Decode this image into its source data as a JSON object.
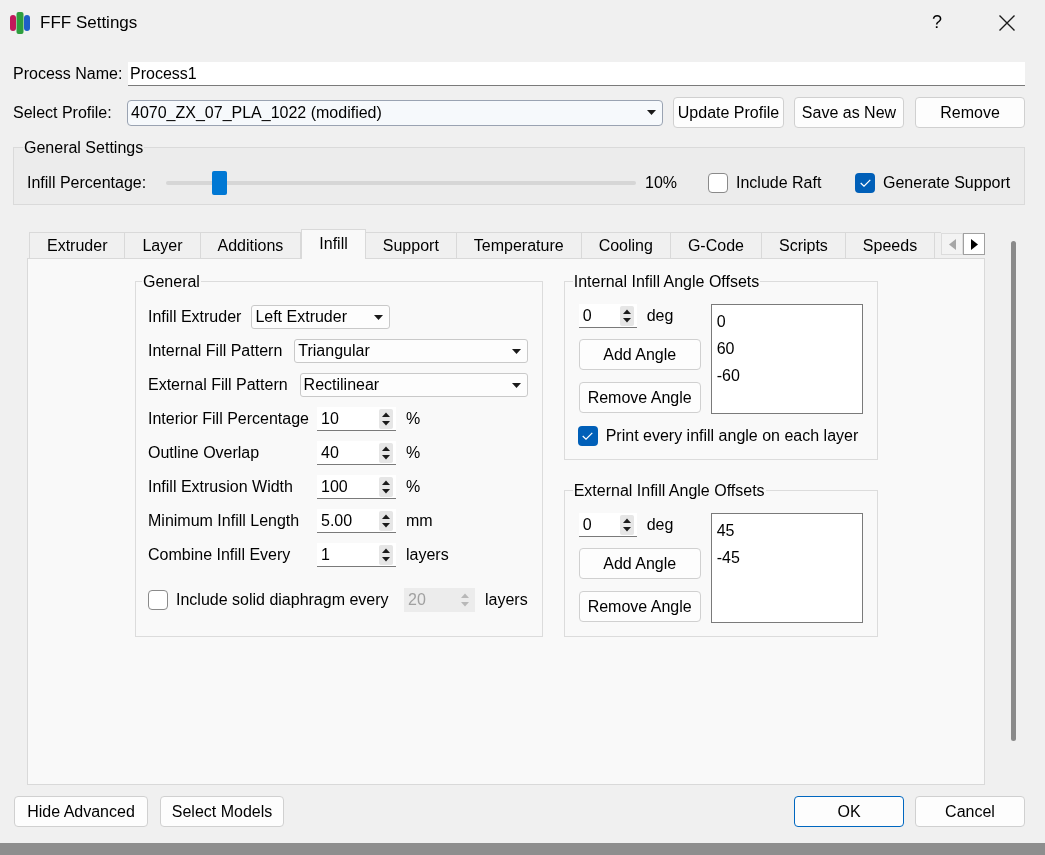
{
  "window": {
    "title": "FFF Settings",
    "help": "?"
  },
  "process_name": {
    "label": "Process Name:",
    "value": "Process1"
  },
  "profile": {
    "label": "Select Profile:",
    "value": "4070_ZX_07_PLA_1022 (modified)",
    "buttons": [
      "Update Profile",
      "Save as New",
      "Remove"
    ]
  },
  "general_settings": {
    "title": "General Settings",
    "infill": {
      "label": "Infill Percentage:",
      "level": 0.1,
      "reading": "10%"
    },
    "checkboxes": [
      {
        "label": "Include Raft",
        "checked": false
      },
      {
        "label": "Generate Support",
        "checked": true
      }
    ]
  },
  "tabs": [
    {
      "label": "Extruder",
      "selected": false
    },
    {
      "label": "Layer",
      "selected": false
    },
    {
      "label": "Additions",
      "selected": false
    },
    {
      "label": "Infill",
      "selected": true
    },
    {
      "label": "Support",
      "selected": false
    },
    {
      "label": "Temperature",
      "selected": false
    },
    {
      "label": "Cooling",
      "selected": false
    },
    {
      "label": "G-Code",
      "selected": false
    },
    {
      "label": "Scripts",
      "selected": false
    },
    {
      "label": "Speeds",
      "selected": false
    }
  ],
  "tab_scroll": {
    "back_enabled": false,
    "forward_enabled": true
  },
  "general": {
    "title": "General",
    "rows": [
      {
        "kind": "combo",
        "label": "Infill Extruder",
        "value": "Left Extruder"
      },
      {
        "kind": "combo",
        "label": "Internal Fill Pattern",
        "value": "Triangular"
      },
      {
        "kind": "combo",
        "label": "External Fill Pattern",
        "value": "Rectilinear"
      },
      {
        "kind": "spin",
        "label": "Interior Fill Percentage",
        "value": "10",
        "unit": "%"
      },
      {
        "kind": "spin",
        "label": "Outline Overlap",
        "value": "40",
        "unit": "%"
      },
      {
        "kind": "spin",
        "label": "Infill Extrusion Width",
        "value": "100",
        "unit": "%"
      },
      {
        "kind": "spin",
        "label": "Minimum Infill Length",
        "value": "5.00",
        "unit": "mm"
      },
      {
        "kind": "spin",
        "label": "Combine Infill Every",
        "value": "1",
        "unit": "layers"
      }
    ],
    "diaphragm": {
      "label": "Include solid diaphragm every",
      "checked": false,
      "value": "20",
      "unit": "layers",
      "disabled": true
    }
  },
  "angle_groups": [
    {
      "title": "Internal Infill Angle Offsets",
      "value": "0",
      "unit": "deg",
      "buttons": [
        "Add Angle",
        "Remove Angle"
      ],
      "angles": [
        "0",
        "60",
        "-60"
      ],
      "checkbox": {
        "label": "Print every infill angle on each layer",
        "checked": true
      }
    },
    {
      "title": "External Infill Angle Offsets",
      "value": "0",
      "unit": "deg",
      "buttons": [
        "Add Angle",
        "Remove Angle"
      ],
      "angles": [
        "45",
        "-45"
      ]
    }
  ],
  "footer": {
    "left_buttons": [
      "Hide Advanced",
      "Select Models"
    ],
    "right_buttons": [
      {
        "label": "OK",
        "default": true
      },
      {
        "label": "Cancel",
        "default": false
      }
    ]
  }
}
